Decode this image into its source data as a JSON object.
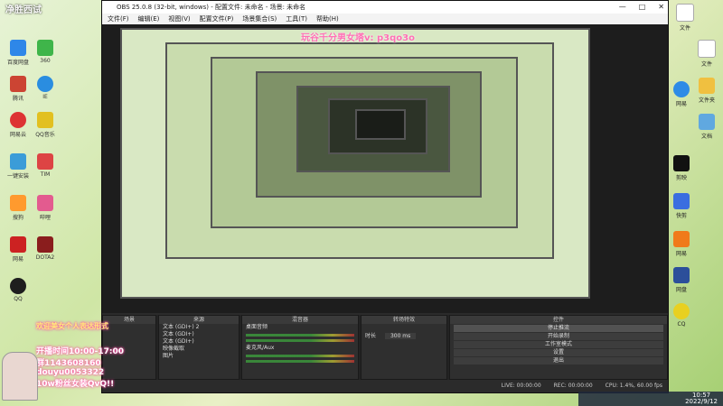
{
  "desktop": {
    "brand_left": "净胜西试",
    "left_icons": [
      "百度网盘",
      "360",
      "腾讯",
      "IE",
      "网易云",
      "QQ音乐",
      "一键安装",
      "TIM",
      "搜狗",
      "哔哩",
      "网易",
      "DOTA2",
      "QQ"
    ],
    "right_icons": [
      "文件",
      "文件夹",
      "网易",
      "文档",
      "剪映",
      "快剪",
      "网易",
      "网盘",
      "CQ",
      "文件"
    ]
  },
  "obs": {
    "title": "OBS 25.0.8 (32-bit, windows) - 配置文件: 未命名 - 场景: 未命名",
    "menu": [
      "文件(F)",
      "编辑(E)",
      "视图(V)",
      "配置文件(P)",
      "场景集合(S)",
      "工具(T)",
      "帮助(H)"
    ],
    "overlay_top": "玩谷千分男女塔v: p3qo3o",
    "docks": {
      "scenes_title": "场景",
      "sources_title": "来源",
      "sources": [
        "文本 (GDI+) 2",
        "文本 (GDI+)",
        "文本 (GDI+)",
        "映像截取",
        "图片"
      ],
      "mixer_title": "混音器",
      "mixer_tracks": [
        "桌面音频",
        "麦克风/Aux"
      ],
      "transition_title": "转场特效",
      "transition_duration_label": "时长",
      "transition_duration_value": "300 ms",
      "controls_title": "控件",
      "controls": [
        "停止推流",
        "开始录制",
        "工作室模式",
        "设置",
        "退出"
      ]
    },
    "status": {
      "live": "LIVE: 00:00:00",
      "rec": "REC: 00:00:00",
      "cpu": "CPU: 1.4%, 60.00 fps"
    }
  },
  "streamer": {
    "lines": [
      "开播时间10:00-17:00",
      "群1143608160",
      "douyu0053322",
      "10w粉丝女装QvQ!!"
    ],
    "banner": "欢迎美女个人表达形式"
  },
  "tray": {
    "time": "10:57",
    "date": "2022/9/12"
  }
}
